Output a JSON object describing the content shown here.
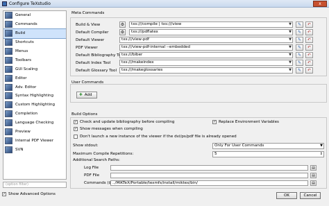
{
  "window": {
    "title": "Configure TeXstudio",
    "close_label": "x"
  },
  "sidebar": {
    "items": [
      {
        "label": "General",
        "icon": "general-icon"
      },
      {
        "label": "Commands",
        "icon": "commands-icon"
      },
      {
        "label": "Build",
        "icon": "build-icon",
        "selected": true
      },
      {
        "label": "Shortcuts",
        "icon": "shortcuts-icon"
      },
      {
        "label": "Menus",
        "icon": "menus-icon"
      },
      {
        "label": "Toolbars",
        "icon": "toolbars-icon"
      },
      {
        "label": "GUI Scaling",
        "icon": "gui-scaling-icon"
      },
      {
        "label": "Editor",
        "icon": "editor-icon"
      },
      {
        "label": "Adv. Editor",
        "icon": "adv-editor-icon"
      },
      {
        "label": "Syntax Highlighting",
        "icon": "syntax-icon"
      },
      {
        "label": "Custom Highlighting",
        "icon": "custom-highlighting-icon"
      },
      {
        "label": "Completion",
        "icon": "completion-icon"
      },
      {
        "label": "Language Checking",
        "icon": "language-icon"
      },
      {
        "label": "Preview",
        "icon": "preview-icon"
      },
      {
        "label": "Internal PDF Viewer",
        "icon": "pdf-viewer-icon"
      },
      {
        "label": "SVN",
        "icon": "svn-icon"
      }
    ],
    "filter_placeholder": "(option filter)",
    "show_advanced_label": "Show Advanced Options",
    "show_advanced_checked": true
  },
  "meta_commands": {
    "title": "Meta Commands",
    "rows": [
      {
        "label": "Build & View",
        "value": "txs:///compile | txs:///view",
        "wizard": true
      },
      {
        "label": "Default Compiler",
        "value": "txs:///pdflatex",
        "wizard": true
      },
      {
        "label": "Default Viewer",
        "value": "txs:///view-pdf"
      },
      {
        "label": "PDF Viewer",
        "value": "txs:///view-pdf-internal --embedded"
      },
      {
        "label": "Default Bibliography Tool",
        "value": "txs:///biber"
      },
      {
        "label": "Default Index Tool",
        "value": "txs:///makeindex"
      },
      {
        "label": "Default Glossary Tool",
        "value": "txs:///makeglossaries"
      }
    ]
  },
  "user_commands": {
    "title": "User Commands",
    "add_label": "Add"
  },
  "build_options": {
    "title": "Build Options",
    "check_before_compile": {
      "label": "Check and update bibliography before compiling",
      "checked": true
    },
    "replace_env_vars": {
      "label": "Replace Environment Variables",
      "checked": true
    },
    "show_messages": {
      "label": "Show messages when compiling",
      "checked": true
    },
    "dont_launch": {
      "label": "Don't launch a new instance of the viewer if the dvi/ps/pdf file is already opened",
      "checked": false
    },
    "show_stdout": {
      "label": "Show stdout:",
      "value": "Only For User Commands"
    },
    "max_reps": {
      "label": "Maximum Compile Repetitions:",
      "value": "5"
    },
    "search_paths": {
      "label": "Additional Search Paths:",
      "log_label": "Log File",
      "log_value": "",
      "pdf_label": "PDF File",
      "pdf_value": "",
      "commands_label": "Commands ($PATH)",
      "commands_value": "../MiKTeX/Portable/texmfs/install/miktex/bin/"
    }
  },
  "dialog": {
    "ok_label": "OK",
    "cancel_label": "Cancel"
  }
}
